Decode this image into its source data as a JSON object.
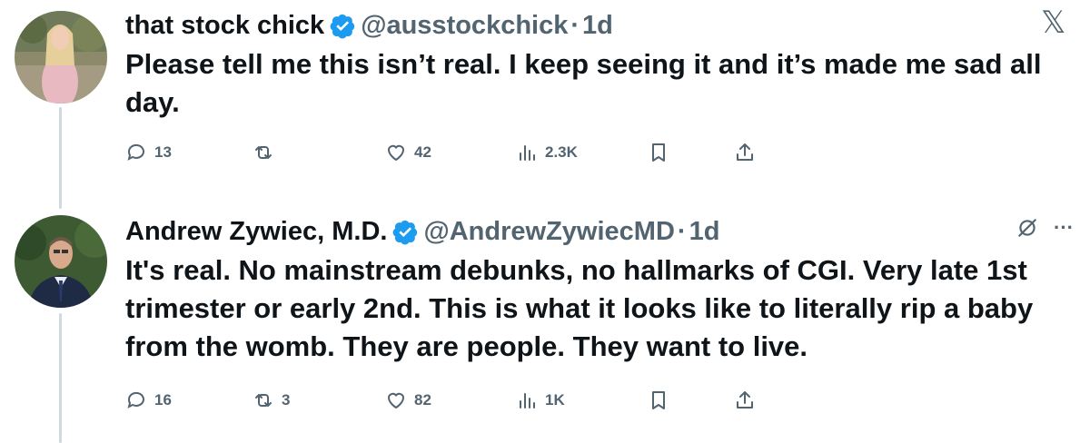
{
  "colors": {
    "text": "#0f1419",
    "muted": "#536471",
    "verified_blue": "#1d9bf0",
    "thread_line": "#cfd9de"
  },
  "x_logo": "𝕏",
  "tweets": [
    {
      "name": "that stock chick",
      "handle": "@ausstockchick",
      "dot": "·",
      "time": "1d",
      "text": "Please tell me this isn’t real. I keep seeing it and it’s made me sad all day.",
      "replies": "13",
      "retweets": "",
      "likes": "42",
      "views": "2.3K"
    },
    {
      "name": "Andrew Zywiec, M.D.",
      "handle": "@AndrewZywiecMD",
      "dot": "·",
      "time": "1d",
      "text": "It's real. No mainstream debunks, no hallmarks of CGI. Very late 1st trimester or early 2nd. This is what it looks like to literally rip a baby from the womb. They are people. They want to live.",
      "replies": "16",
      "retweets": "3",
      "likes": "82",
      "views": "1K",
      "more_label": "···"
    }
  ]
}
